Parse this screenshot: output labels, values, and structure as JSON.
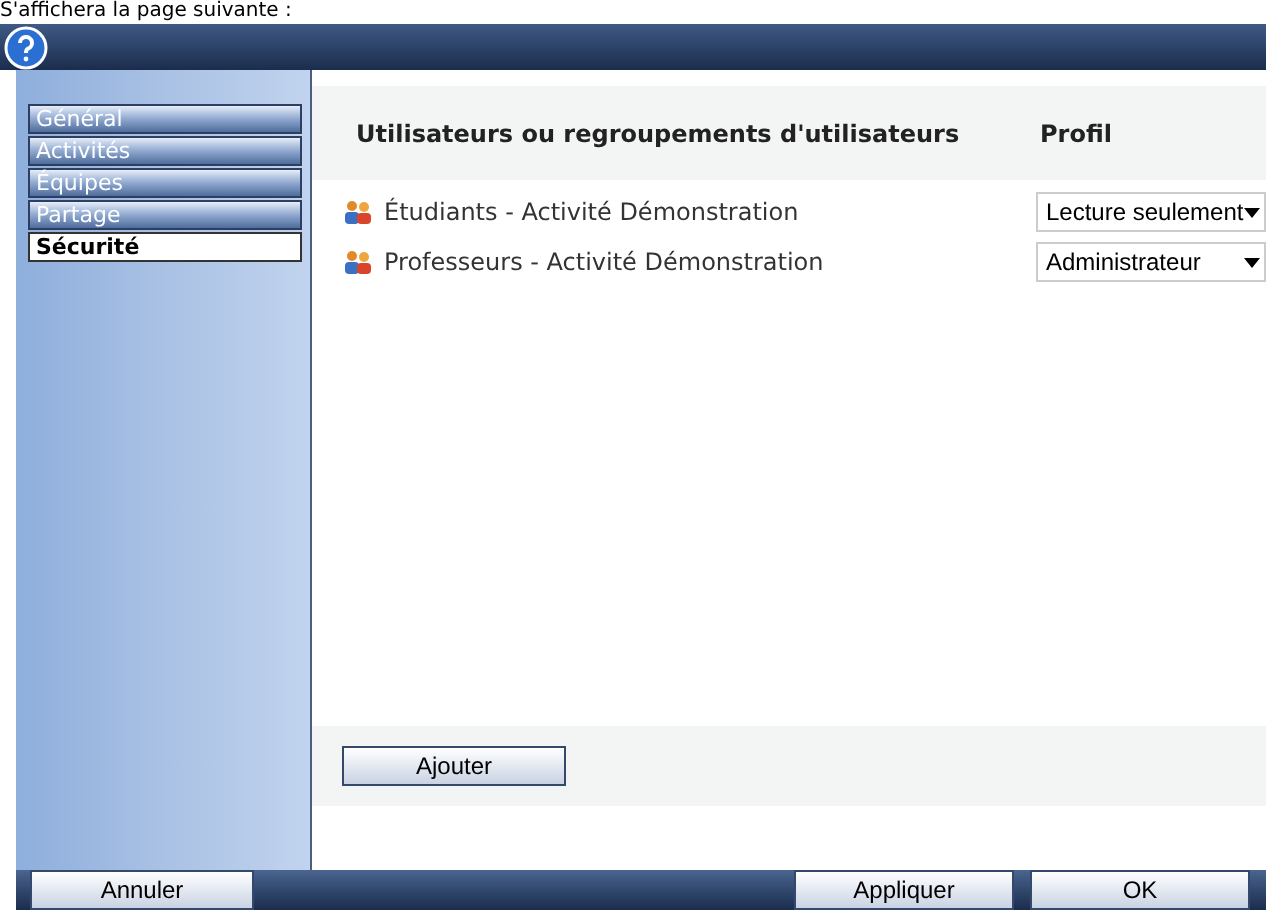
{
  "caption": "S'affichera la page suivante :",
  "sidebar": {
    "items": [
      {
        "label": "Général",
        "selected": false
      },
      {
        "label": "Activités",
        "selected": false
      },
      {
        "label": "Équipes",
        "selected": false
      },
      {
        "label": "Partage",
        "selected": false
      },
      {
        "label": "Sécurité",
        "selected": true
      }
    ]
  },
  "table": {
    "columns": [
      "Utilisateurs ou regroupements d'utilisateurs",
      "Profil"
    ],
    "rows": [
      {
        "name": "Étudiants - Activité Démonstration",
        "profile": "Lecture seulement"
      },
      {
        "name": "Professeurs - Activité Démonstration",
        "profile": "Administrateur"
      }
    ]
  },
  "add_button": "Ajouter",
  "footer": {
    "left": [
      "Annuler"
    ],
    "right": [
      "Appliquer",
      "OK"
    ]
  }
}
